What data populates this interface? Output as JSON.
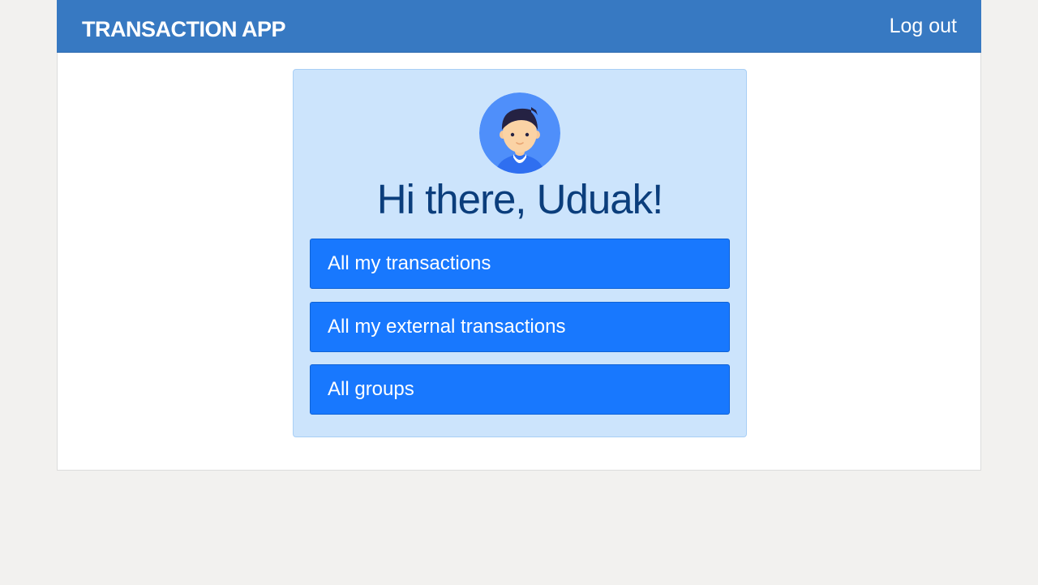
{
  "navbar": {
    "brand": "TRANSACTION APP",
    "logout_label": "Log out"
  },
  "profile": {
    "avatar_icon": "user-avatar-icon",
    "greeting": "Hi there, Uduak!"
  },
  "menu": {
    "items": [
      {
        "label": "All my transactions"
      },
      {
        "label": "All my external transactions"
      },
      {
        "label": "All groups"
      }
    ]
  },
  "colors": {
    "navbar": "#3779c2",
    "card_bg": "#cce4fc",
    "button": "#1878fe",
    "greeting_text": "#0b3e7c",
    "page_bg": "#f2f1ef"
  }
}
